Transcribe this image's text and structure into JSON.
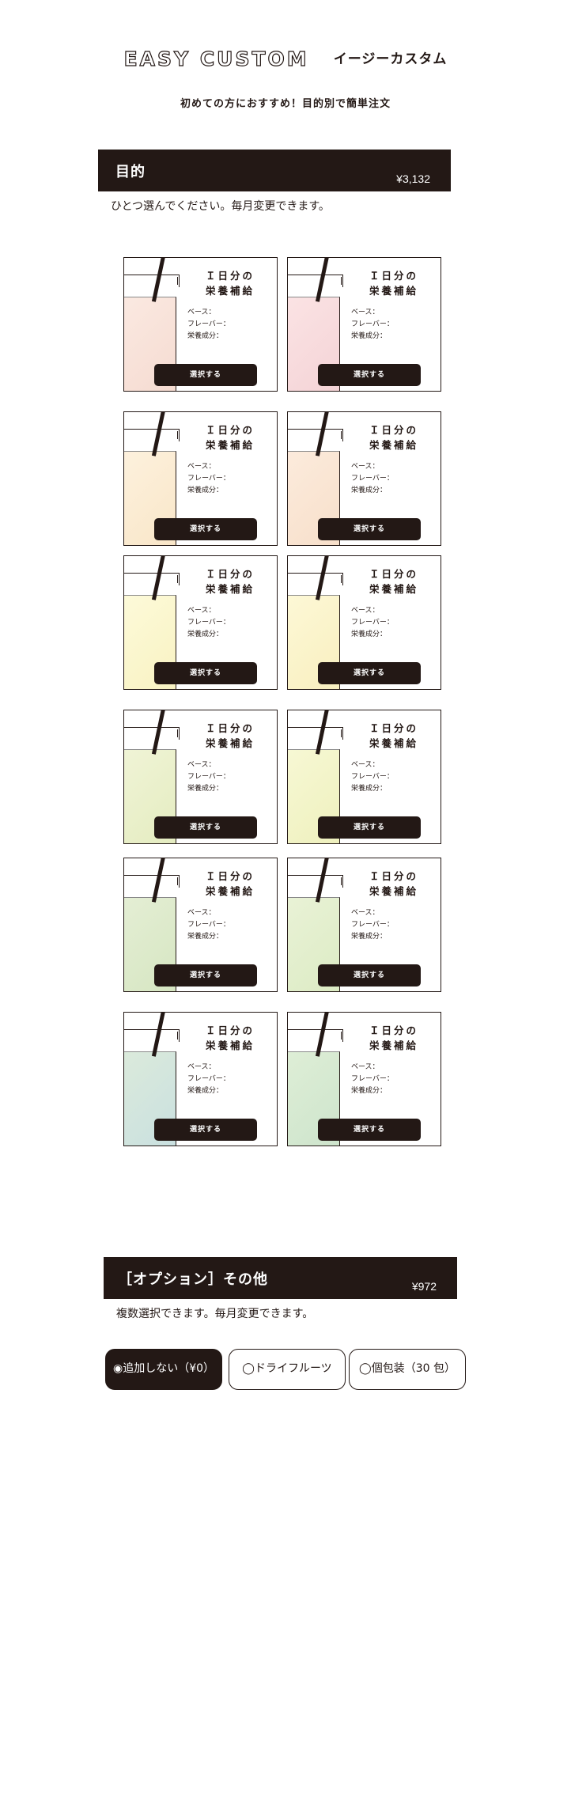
{
  "header": {
    "title_en": "EASY CUSTOM",
    "title_ja": "イージーカスタム",
    "subtitle": "初めての方におすすめ！目的別で簡単注文"
  },
  "purpose_section": {
    "title": "目的",
    "price": "¥3,132",
    "note": "ひとつ選んでください。毎月変更できます。"
  },
  "cards": [
    {
      "title_line1": "Ｉ日分の",
      "title_line2": "栄養補給",
      "base_label": "ベース：",
      "flavor_label": "フレーバー：",
      "nutrient_label": "栄養成分：",
      "button": "選択する",
      "color_top": "#fbe9e1",
      "color_bottom": "#f5dbd1"
    },
    {
      "title_line1": "Ｉ日分の",
      "title_line2": "栄養補給",
      "base_label": "ベース：",
      "flavor_label": "フレーバー：",
      "nutrient_label": "栄養成分：",
      "button": "選択する",
      "color_top": "#fbe3e4",
      "color_bottom": "#f4d3d6"
    },
    {
      "title_line1": "Ｉ日分の",
      "title_line2": "栄養補給",
      "base_label": "ベース：",
      "flavor_label": "フレーバー：",
      "nutrient_label": "栄養成分：",
      "button": "選択する",
      "color_top": "#fdf1dd",
      "color_bottom": "#f9e6c8"
    },
    {
      "title_line1": "Ｉ日分の",
      "title_line2": "栄養補給",
      "base_label": "ベース：",
      "flavor_label": "フレーバー：",
      "nutrient_label": "栄養成分：",
      "button": "選択する",
      "color_top": "#fcebdc",
      "color_bottom": "#f7dfca"
    },
    {
      "title_line1": "Ｉ日分の",
      "title_line2": "栄養補給",
      "base_label": "ベース：",
      "flavor_label": "フレーバー：",
      "nutrient_label": "栄養成分：",
      "button": "選択する",
      "color_top": "#fdfad9",
      "color_bottom": "#f8f2c2"
    },
    {
      "title_line1": "Ｉ日分の",
      "title_line2": "栄養補給",
      "base_label": "ベース：",
      "flavor_label": "フレーバー：",
      "nutrient_label": "栄養成分：",
      "button": "選択する",
      "color_top": "#fdf8d6",
      "color_bottom": "#f8efbf"
    },
    {
      "title_line1": "Ｉ日分の",
      "title_line2": "栄養補給",
      "base_label": "ベース：",
      "flavor_label": "フレーバー：",
      "nutrient_label": "栄養成分：",
      "button": "選択する",
      "color_top": "#f0f4d6",
      "color_bottom": "#e4ecc0"
    },
    {
      "title_line1": "Ｉ日分の",
      "title_line2": "栄養補給",
      "base_label": "ベース：",
      "flavor_label": "フレーバー：",
      "nutrient_label": "栄養成分：",
      "button": "選択する",
      "color_top": "#f7f8d4",
      "color_bottom": "#eef0bd"
    },
    {
      "title_line1": "Ｉ日分の",
      "title_line2": "栄養補給",
      "base_label": "ベース：",
      "flavor_label": "フレーバー：",
      "nutrient_label": "栄養成分：",
      "button": "選択する",
      "color_top": "#e4eed4",
      "color_bottom": "#d6e6c2"
    },
    {
      "title_line1": "Ｉ日分の",
      "title_line2": "栄養補給",
      "base_label": "ベース：",
      "flavor_label": "フレーバー：",
      "nutrient_label": "栄養成分：",
      "button": "選択する",
      "color_top": "#e9f2d6",
      "color_bottom": "#dcebc4"
    },
    {
      "title_line1": "Ｉ日分の",
      "title_line2": "栄養補給",
      "base_label": "ベース：",
      "flavor_label": "フレーバー：",
      "nutrient_label": "栄養成分：",
      "button": "選択する",
      "color_top": "#dbeadb",
      "color_bottom": "#c9e0e0"
    },
    {
      "title_line1": "Ｉ日分の",
      "title_line2": "栄養補給",
      "base_label": "ベース：",
      "flavor_label": "フレーバー：",
      "nutrient_label": "栄養成分：",
      "button": "選択する",
      "color_top": "#deeed6",
      "color_bottom": "#cde4cc"
    }
  ],
  "option_section": {
    "title": "［オプション］その他",
    "price": "¥972",
    "note": "複数選択できます。毎月変更できます。",
    "options": [
      {
        "label": "◉追加しない（¥0）",
        "selected": true
      },
      {
        "label": "◯ドライフルーツ",
        "selected": false
      },
      {
        "label": "◯個包装（30 包）",
        "selected": false
      }
    ]
  }
}
